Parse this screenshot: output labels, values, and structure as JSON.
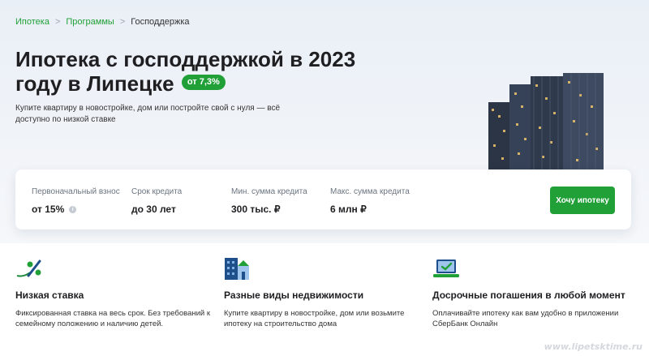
{
  "breadcrumb": {
    "items": [
      {
        "label": "Ипотека"
      },
      {
        "label": "Программы"
      },
      {
        "label": "Господдержка"
      }
    ]
  },
  "hero": {
    "title": "Ипотека с господдержкой в 2023 году в Липецке",
    "rate_badge": "от 7,3%",
    "subtitle": "Купите квартиру в новостройке, дом или постройте свой с нуля — всё доступно по низкой ставке"
  },
  "params": [
    {
      "label": "Первоначальный взнос",
      "value": "от 15%"
    },
    {
      "label": "Срок кредита",
      "value": "до 30 лет"
    },
    {
      "label": "Мин. сумма кредита",
      "value": "300 тыс. ₽"
    },
    {
      "label": "Макс. сумма кредита",
      "value": "6 млн ₽"
    }
  ],
  "cta": {
    "label": "Хочу ипотеку"
  },
  "features": [
    {
      "icon": "percent-icon",
      "title": "Низкая ставка",
      "text": "Фиксированная ставка на весь срок. Без требований к семейному положению и наличию детей."
    },
    {
      "icon": "buildings-icon",
      "title": "Разные виды недвижимости",
      "text": "Купите квартиру в новостройке, дом или возьмите ипотеку на строительство дома"
    },
    {
      "icon": "laptop-icon",
      "title": "Досрочные погашения в любой момент",
      "text": "Оплачивайте ипотеку как вам удобно в приложении СберБанк Онлайн"
    }
  ],
  "watermark": "www.lipetsktime.ru",
  "colors": {
    "accent": "#21a038",
    "text": "#1f1f22",
    "muted": "#6b7580"
  }
}
